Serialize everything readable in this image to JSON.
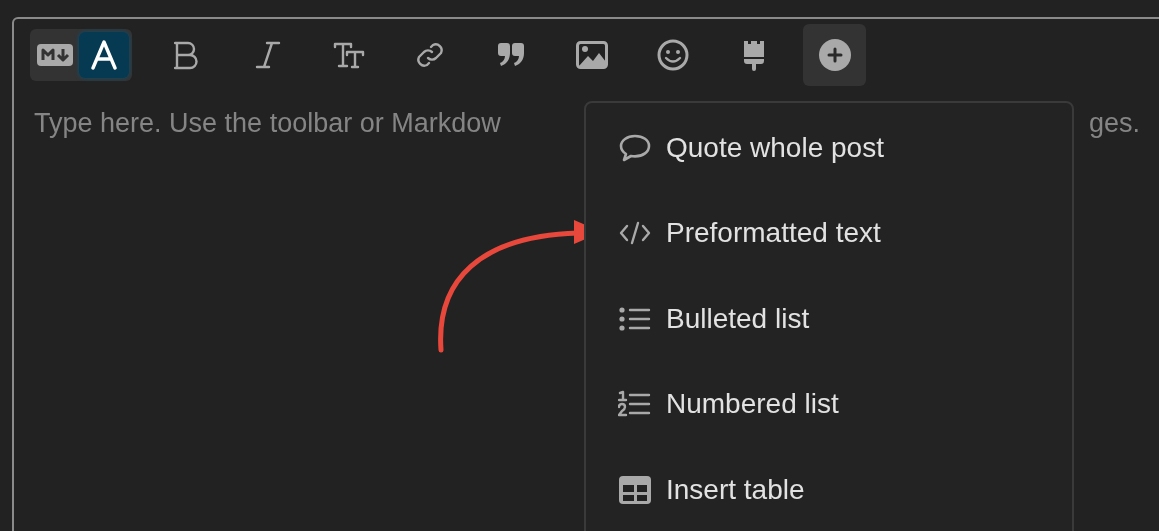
{
  "editor": {
    "mode_toggle": [
      {
        "kind": "markdown",
        "selected": false
      },
      {
        "kind": "rich",
        "selected": true
      }
    ],
    "toolbar": [
      {
        "kind": "bold"
      },
      {
        "kind": "italic"
      },
      {
        "kind": "heading"
      },
      {
        "kind": "link"
      },
      {
        "kind": "quote"
      },
      {
        "kind": "image"
      },
      {
        "kind": "emoji"
      },
      {
        "kind": "brush"
      },
      {
        "kind": "options",
        "expanded": true
      }
    ],
    "placeholder_start": "Type here. Use the toolbar or Markdow",
    "placeholder_end": "ges."
  },
  "menu": {
    "items": [
      {
        "kind": "quote",
        "label": "Quote whole post"
      },
      {
        "kind": "code",
        "label": "Preformatted text"
      },
      {
        "kind": "bullets",
        "label": "Bulleted list"
      },
      {
        "kind": "numbers",
        "label": "Numbered list"
      },
      {
        "kind": "table",
        "label": "Insert table"
      }
    ]
  }
}
